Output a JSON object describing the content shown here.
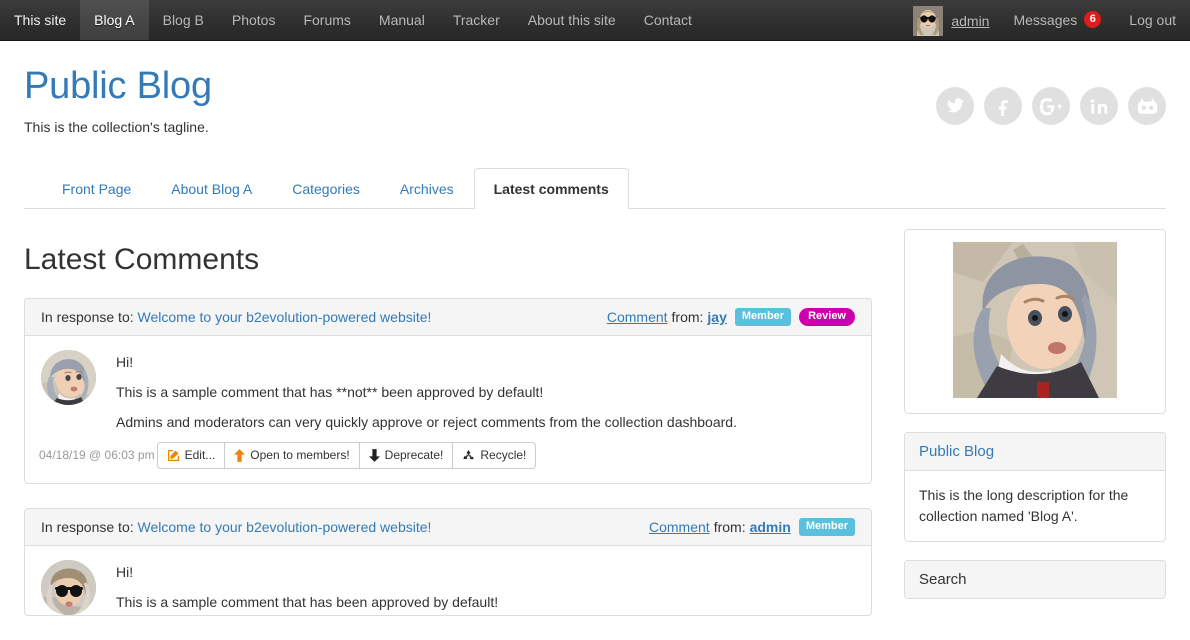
{
  "evobar": {
    "left_items": [
      {
        "label": "This site",
        "active": false,
        "first": true
      },
      {
        "label": "Blog A",
        "active": true,
        "first": false
      },
      {
        "label": "Blog B",
        "active": false,
        "first": false
      },
      {
        "label": "Photos",
        "active": false,
        "first": false
      },
      {
        "label": "Forums",
        "active": false,
        "first": false
      },
      {
        "label": "Manual",
        "active": false,
        "first": false
      },
      {
        "label": "Tracker",
        "active": false,
        "first": false
      },
      {
        "label": "About this site",
        "active": false,
        "first": false
      },
      {
        "label": "Contact",
        "active": false,
        "first": false
      }
    ],
    "user_name": "admin",
    "avatar_icon": "user-avatar-sunglasses",
    "messages_label": "Messages",
    "messages_count": "6",
    "logout_label": "Log out"
  },
  "header": {
    "site_title": "Public Blog",
    "tagline": "This is the collection's tagline.",
    "social": [
      {
        "name": "twitter-icon"
      },
      {
        "name": "facebook-icon"
      },
      {
        "name": "googleplus-icon"
      },
      {
        "name": "linkedin-icon"
      },
      {
        "name": "github-icon"
      }
    ]
  },
  "tabs": [
    {
      "label": "Front Page",
      "active": false
    },
    {
      "label": "About Blog A",
      "active": false
    },
    {
      "label": "Categories",
      "active": false
    },
    {
      "label": "Archives",
      "active": false
    },
    {
      "label": "Latest comments",
      "active": true
    }
  ],
  "main": {
    "page_title": "Latest Comments",
    "comments": [
      {
        "in_response_label": "In response to:",
        "post_title": "Welcome to your b2evolution-powered website!",
        "from_label": "Comment",
        "from_sep": "from:",
        "author": "jay",
        "badges": [
          {
            "label": "Member",
            "kind": "member"
          },
          {
            "label": "Review",
            "kind": "review"
          }
        ],
        "avatar_icon": "baby-bonnet-avatar",
        "lines": [
          "Hi!",
          "This is a sample comment that has **not** been approved by default!",
          "Admins and moderators can very quickly approve or reject comments from the collection dashboard."
        ],
        "date": "04/18/19 @ 06:03 pm",
        "actions": [
          {
            "label": "Edit...",
            "icon": "pencil-square-icon",
            "color": "orange"
          },
          {
            "label": "Open to members!",
            "icon": "arrow-up-icon",
            "color": "orange"
          },
          {
            "label": "Deprecate!",
            "icon": "arrow-down-icon",
            "color": "dark"
          },
          {
            "label": "Recycle!",
            "icon": "recycle-icon",
            "color": "dark"
          }
        ]
      },
      {
        "in_response_label": "In response to:",
        "post_title": "Welcome to your b2evolution-powered website!",
        "from_label": "Comment",
        "from_sep": "from:",
        "author": "admin",
        "badges": [
          {
            "label": "Member",
            "kind": "member"
          }
        ],
        "avatar_icon": "sunglasses-child-avatar",
        "lines": [
          "Hi!",
          "This is a sample comment that has been approved by default!"
        ],
        "date": "",
        "actions": []
      }
    ]
  },
  "sidebar": {
    "image_widget": {
      "image_icon": "baby-bonnet-photo"
    },
    "about": {
      "title": "Public Blog",
      "body": "This is the long description for the collection named 'Blog A'."
    },
    "search": {
      "title": "Search"
    }
  }
}
